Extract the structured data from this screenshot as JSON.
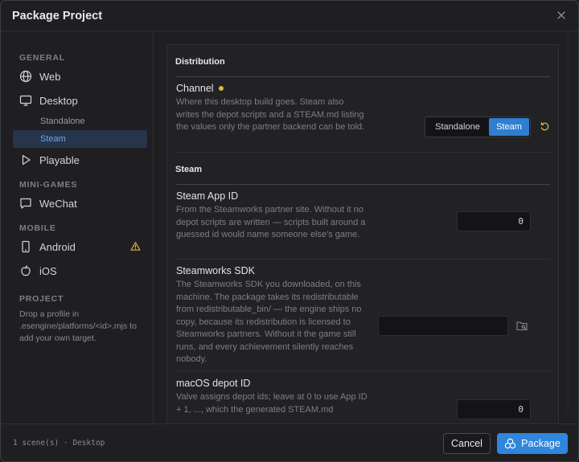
{
  "dialog": {
    "title": "Package Project"
  },
  "sidebar": {
    "sections": {
      "general": "GENERAL",
      "mini_games": "MINI-GAMES",
      "mobile": "MOBILE",
      "project": "PROJECT"
    },
    "items": {
      "web": "Web",
      "desktop": "Desktop",
      "standalone": "Standalone",
      "steam": "Steam",
      "playable": "Playable",
      "wechat": "WeChat",
      "android": "Android",
      "ios": "iOS"
    },
    "active_item": "Steam",
    "project_hint": "Drop a profile in .esengine/platforms/<id>.mjs to add your own target."
  },
  "main": {
    "distribution": {
      "heading": "Distribution",
      "channel": {
        "label": "Channel",
        "description": "Where this desktop build goes. Steam also writes the depot scripts and a STEAM.md listing the values only the partner backend can be told.",
        "options": [
          "Standalone",
          "Steam"
        ],
        "selected": "Steam"
      }
    },
    "steam": {
      "heading": "Steam",
      "app_id": {
        "label": "Steam App ID",
        "description": "From the Steamworks partner site. Without it no depot scripts are written — scripts built around a guessed id would name someone else's game.",
        "value": "0"
      },
      "sdk": {
        "label": "Steamworks SDK",
        "description": "The Steamworks SDK you downloaded, on this machine. The package takes its redistributable from redistributable_bin/ — the engine ships no copy, because its redistribution is licensed to Steamworks partners. Without it the game still runs, and every achievement silently reaches nobody.",
        "value": ""
      },
      "macos_depot": {
        "label": "macOS depot ID",
        "description": "Valve assigns depot ids; leave at 0 to use App ID + 1, ..., which the generated STEAM.md",
        "value": "0"
      }
    }
  },
  "footer": {
    "status": "1 scene(s) · Desktop",
    "cancel_label": "Cancel",
    "package_label": "Package"
  },
  "colors": {
    "accent": "#2f86dc",
    "selected_nav_bg": "#26354b",
    "selected_nav_text": "#6aa8ea",
    "modified_dot": "#e0b83c",
    "warning": "#e0b83c"
  }
}
